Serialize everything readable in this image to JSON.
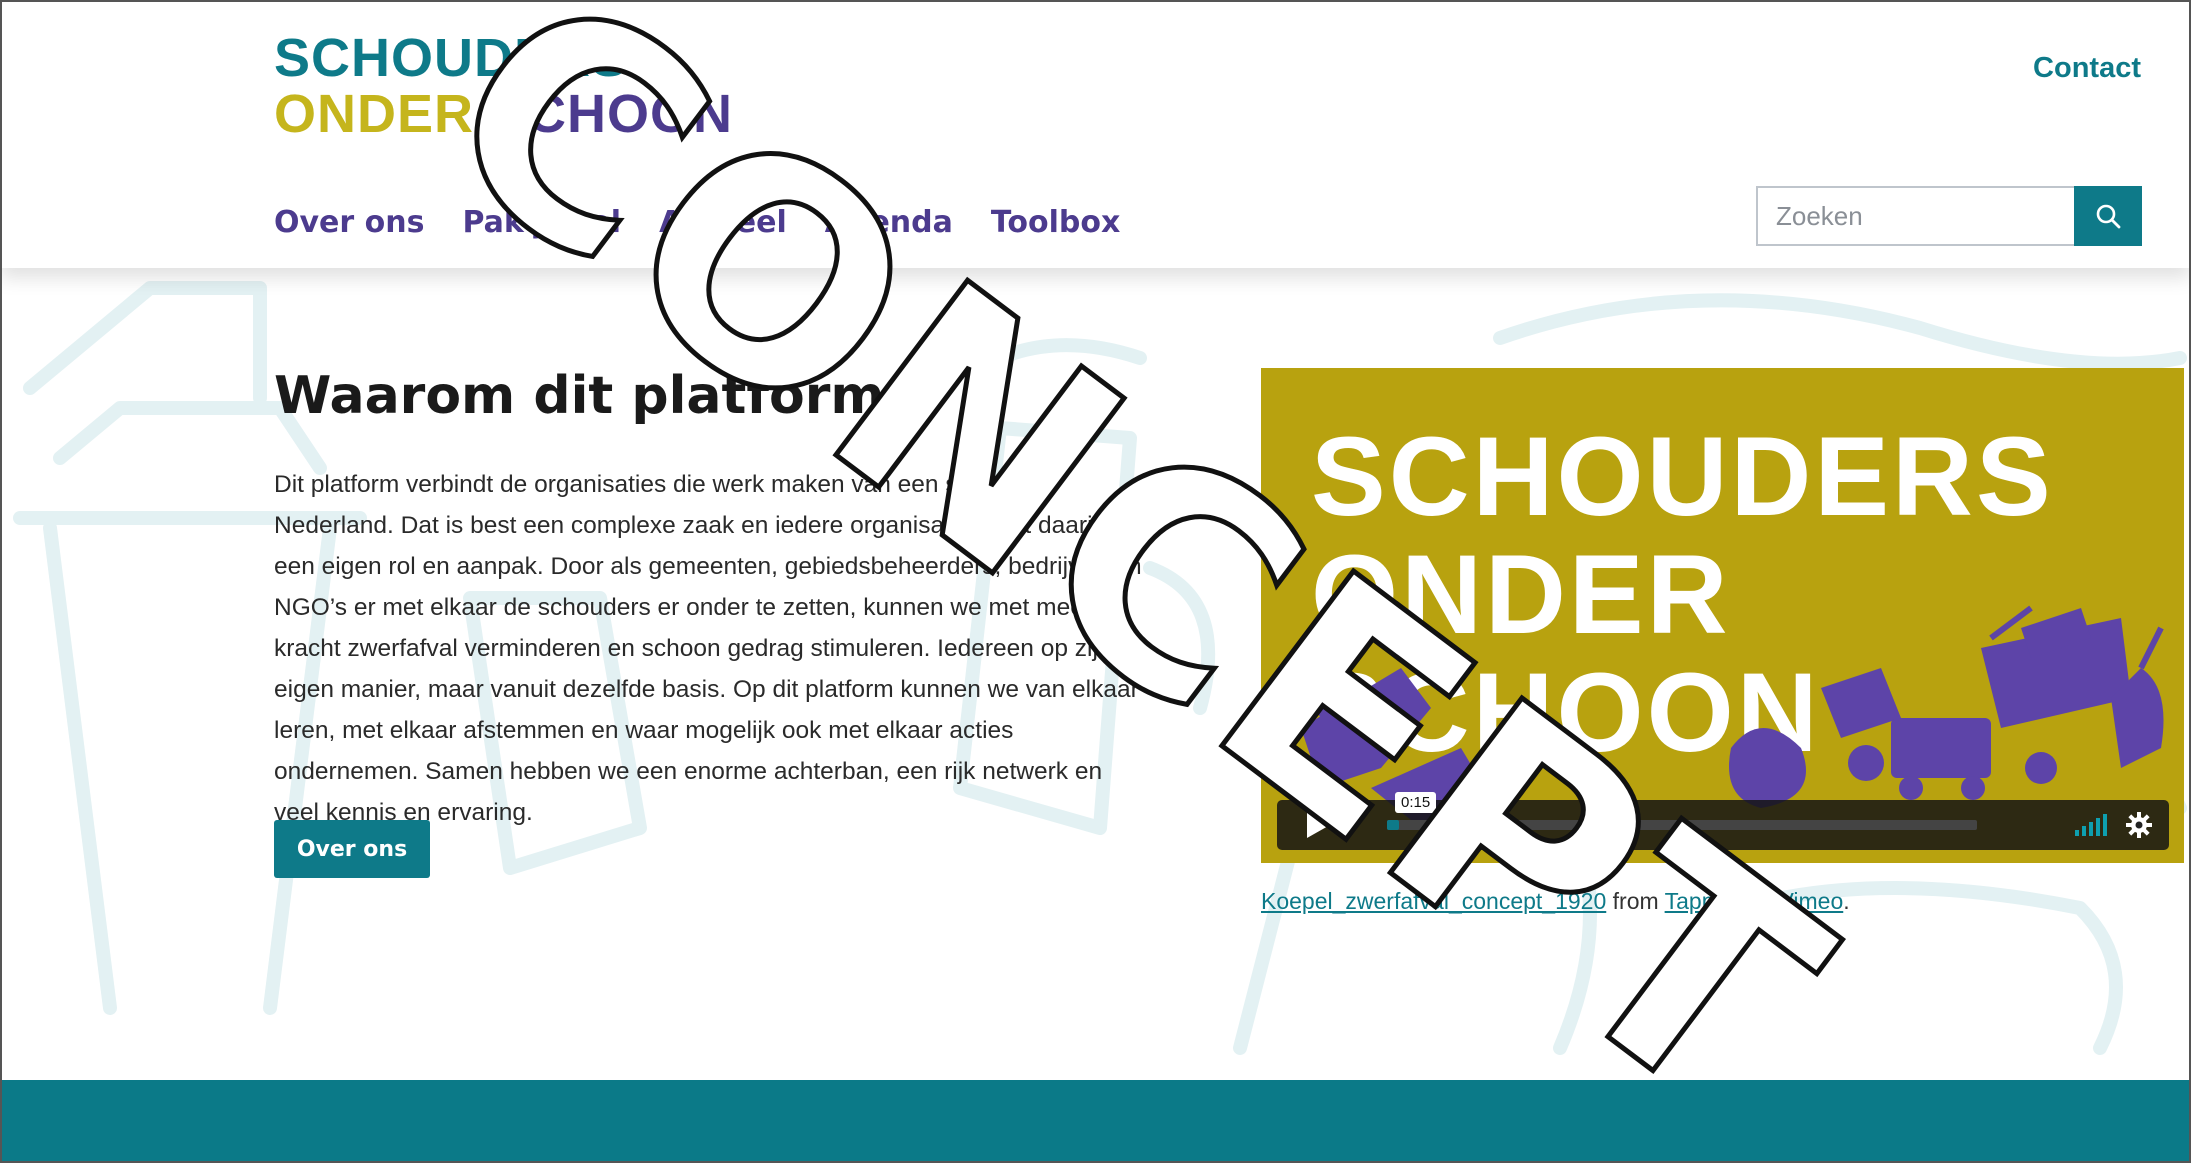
{
  "logo": {
    "line1": "SCHOUDERS",
    "line2_part1": "ONDER",
    "line2_part2": "SCHOON"
  },
  "header": {
    "contact_label": "Contact"
  },
  "nav": {
    "items": [
      {
        "label": "Over ons"
      },
      {
        "label": "Pak je rol"
      },
      {
        "label": "Actueel"
      },
      {
        "label": "Agenda"
      },
      {
        "label": "Toolbox"
      }
    ]
  },
  "search": {
    "placeholder": "Zoeken",
    "icon": "search-icon"
  },
  "main": {
    "title": "Waarom dit platform",
    "paragraph": "Dit platform verbindt de organisaties die werk maken van een schoon Nederland. Dat is best een complexe zaak en iedere organisatie heeft daarin een eigen rol en aanpak. Door als gemeenten, gebiedsbeheerders, bedrijven en NGO’s er met elkaar de schouders er onder te zetten, kunnen we met meer kracht zwerfafval verminderen en schoon gedrag stimuleren. Iedereen op zijn eigen manier, maar vanuit dezelfde basis. Op dit platform kunnen we van elkaar leren, met elkaar afstemmen en waar mogelijk ook met elkaar acties ondernemen. Samen hebben we een enorme achterban, een rijk netwerk en veel kennis en ervaring.",
    "button_label": "Over ons"
  },
  "video": {
    "title_lines": [
      "SCHOUDERS",
      "ONDER",
      "SCHOON"
    ],
    "time": "0:15",
    "progress": 0.02,
    "play_icon": "play-icon",
    "volume_icon": "volume-icon",
    "settings_icon": "gear-icon",
    "background_color": "#b8a20f"
  },
  "caption": {
    "video_link": "Koepel_zwerfafval_concept_1920",
    "from": "from",
    "author_link": "Tappan",
    "on": "on",
    "platform_link": "Vimeo",
    "end": "."
  },
  "watermark": {
    "text": "CONCEPT"
  },
  "colors": {
    "teal": "#0e7a89",
    "purple": "#4c3b8e",
    "yellow": "#c5b51c",
    "footer": "#0b7a88"
  }
}
